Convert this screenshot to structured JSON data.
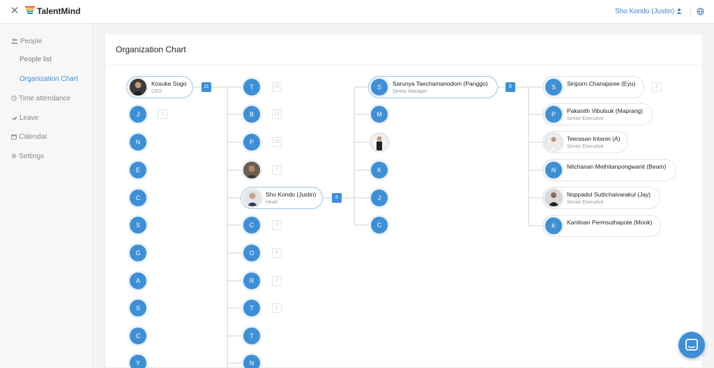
{
  "app": {
    "brand": "TalentMind",
    "user": "Sho Kondo (Justin)"
  },
  "sidebar": {
    "items": [
      {
        "label": "People",
        "icon": "people-icon"
      },
      {
        "label": "People list"
      },
      {
        "label": "Organization Chart"
      },
      {
        "label": "Time attendance",
        "icon": "clock-icon"
      },
      {
        "label": "Leave",
        "icon": "plane-icon"
      },
      {
        "label": "Calendar",
        "icon": "calendar-icon"
      },
      {
        "label": "Settings",
        "icon": "gear-icon"
      }
    ]
  },
  "page": {
    "title": "Organization Chart"
  },
  "org": {
    "col1_root": {
      "name": "Kosuke Sogo",
      "title": "CEO",
      "count": "11"
    },
    "col1_children": [
      {
        "initial": "J",
        "count": "1"
      },
      {
        "initial": "N"
      },
      {
        "initial": "E"
      },
      {
        "initial": "C"
      },
      {
        "initial": "S"
      },
      {
        "initial": "G"
      },
      {
        "initial": "A"
      },
      {
        "initial": "S"
      },
      {
        "initial": "C"
      },
      {
        "initial": "Y"
      }
    ],
    "col2_children": [
      {
        "initial": "T",
        "count": "10"
      },
      {
        "initial": "B",
        "count": "12"
      },
      {
        "initial": "P",
        "count": "10"
      },
      {
        "initial": "",
        "count": "7",
        "photo": true
      },
      {
        "name": "Sho Kondo (Justin)",
        "title": "Head",
        "count": "6",
        "selected": true
      },
      {
        "initial": "C",
        "count": "3"
      },
      {
        "initial": "O",
        "count": "3"
      },
      {
        "initial": "R",
        "count": "2"
      },
      {
        "initial": "T",
        "count": "2"
      },
      {
        "initial": "T"
      },
      {
        "initial": "N"
      }
    ],
    "col3_children": [
      {
        "name": "Sarunya Taechamanodom (Panggo)",
        "title": "Senior Manager",
        "initial": "S",
        "count": "6"
      },
      {
        "initial": "M"
      },
      {
        "initial": "",
        "photo": true
      },
      {
        "initial": "K"
      },
      {
        "initial": "J"
      },
      {
        "initial": "C"
      }
    ],
    "col4_children": [
      {
        "name": "Siriporn Chanajaree (Eyu)",
        "initial": "S",
        "count": "2"
      },
      {
        "name": "Pakanith Vibulsuk (Maprang)",
        "title": "Senior Executive",
        "initial": "P"
      },
      {
        "name": "Teerasan Intanin (A)",
        "title": "Senior Executive",
        "photo": true
      },
      {
        "name": "Nitchanan Methitanpongwanit (Beam)",
        "initial": "N"
      },
      {
        "name": "Noppadol Suttichaivarakul (Jay)",
        "title": "Senior Executive",
        "photo": true
      },
      {
        "name": "Kantinan Permsuthapote (Mook)",
        "initial": "K"
      }
    ]
  },
  "colors": {
    "accent": "#3d8fd6"
  }
}
